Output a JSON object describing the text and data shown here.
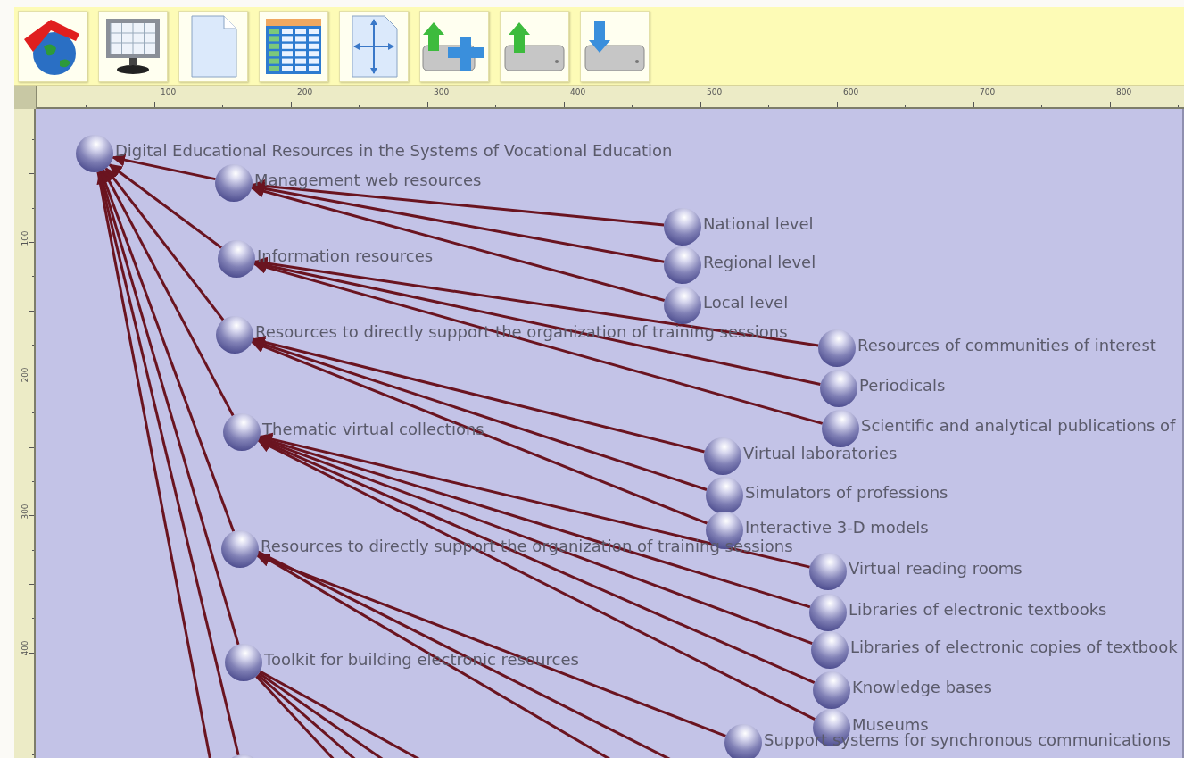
{
  "toolbar": {
    "buttons": [
      {
        "kind": "globe"
      },
      {
        "kind": "monitor"
      },
      {
        "kind": "page"
      },
      {
        "kind": "table"
      },
      {
        "kind": "axes"
      },
      {
        "kind": "drive-add"
      },
      {
        "kind": "drive-up"
      },
      {
        "kind": "drive-down"
      }
    ]
  },
  "top_ruler": {
    "labels": [
      "100",
      "200",
      "300",
      "400",
      "500",
      "600",
      "700",
      "800"
    ]
  },
  "left_ruler": {
    "labels": [
      "100",
      "200",
      "300",
      "400"
    ]
  },
  "graph": {
    "root": {
      "label": "Digital Educational Resources in the Systems of Vocational Education",
      "children": [
        {
          "label": "Management web resources",
          "children": [
            {
              "label": "National level"
            },
            {
              "label": "Regional level"
            },
            {
              "label": "Local level"
            }
          ]
        },
        {
          "label": "Information resources",
          "children": [
            {
              "label": "Resources of communities of interest"
            },
            {
              "label": "Periodicals"
            },
            {
              "label": "Scientific and analytical publications of"
            }
          ]
        },
        {
          "label": "Resources to directly support the organization of training sessions",
          "children": [
            {
              "label": "Virtual laboratories"
            },
            {
              "label": "Simulators of professions"
            },
            {
              "label": "Interactive 3-D models"
            }
          ]
        },
        {
          "label": "Thematic virtual collections",
          "children": [
            {
              "label": "Virtual reading rooms"
            },
            {
              "label": "Libraries of electronic textbooks"
            },
            {
              "label": "Libraries of electronic copies of textbook"
            },
            {
              "label": "Knowledge bases"
            },
            {
              "label": "Museums"
            }
          ]
        },
        {
          "label": "Resources to directly support the organization of training sessions",
          "children": [
            {
              "label": "Support systems for synchronous communications"
            }
          ]
        },
        {
          "label": "Toolkit for building electronic resources"
        }
      ]
    }
  }
}
